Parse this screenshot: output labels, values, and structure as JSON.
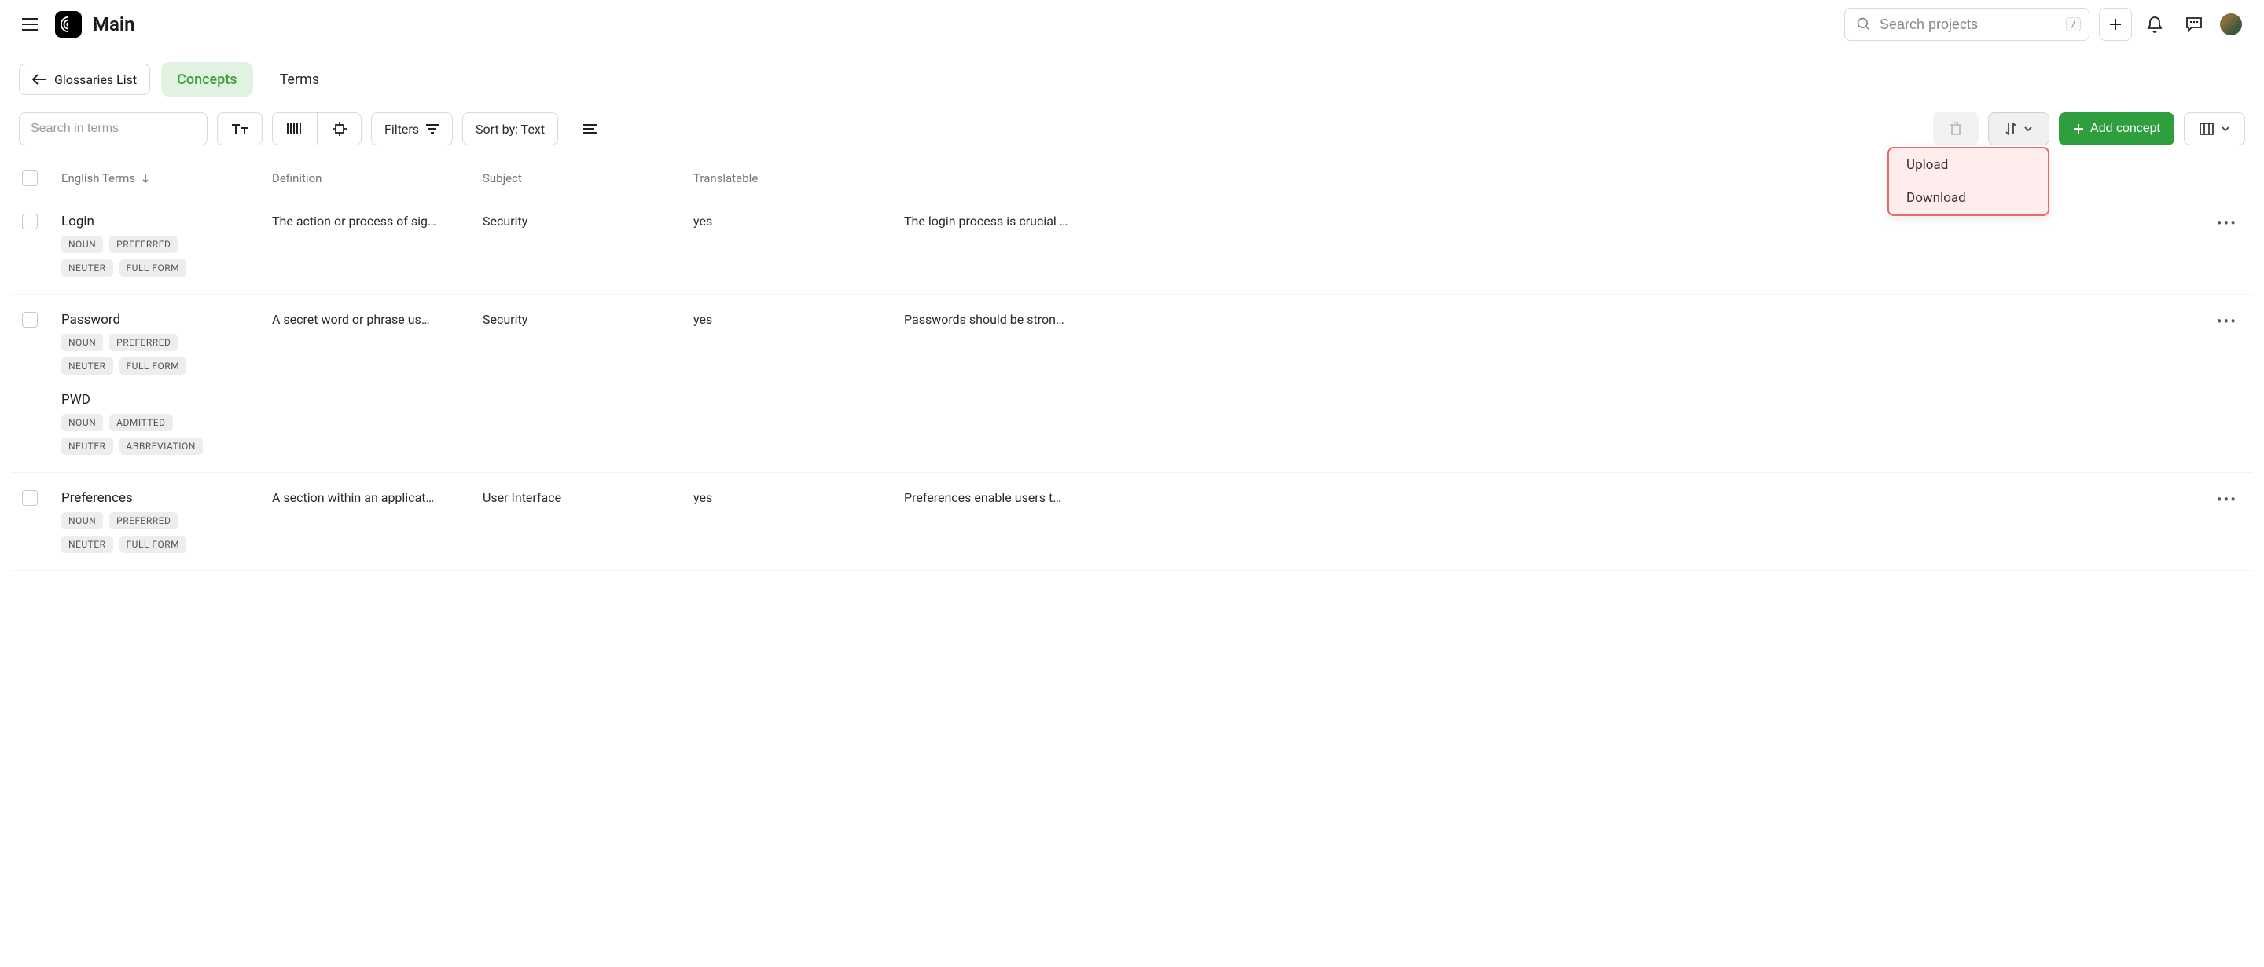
{
  "app": {
    "title": "Main",
    "search_placeholder": "Search projects",
    "search_shortcut": "/"
  },
  "breadcrumb": {
    "back_label": "Glossaries List",
    "tabs": [
      {
        "label": "Concepts",
        "active": true
      },
      {
        "label": "Terms",
        "active": false
      }
    ]
  },
  "toolbar": {
    "search_placeholder": "Search in terms",
    "filters_label": "Filters",
    "sort_label": "Sort by: Text",
    "add_concept_label": "Add concept",
    "upload_download_menu": {
      "upload": "Upload",
      "download": "Download"
    }
  },
  "columns": {
    "term": "English Terms",
    "definition": "Definition",
    "subject": "Subject",
    "translatable": "Translatable",
    "note": ""
  },
  "rows": [
    {
      "term": "Login",
      "tags": [
        "NOUN",
        "PREFERRED",
        "NEUTER",
        "FULL FORM"
      ],
      "variants": [],
      "definition": "The action or process of sig…",
      "subject": "Security",
      "translatable": "yes",
      "note": "The login process is crucial …"
    },
    {
      "term": "Password",
      "tags": [
        "NOUN",
        "PREFERRED",
        "NEUTER",
        "FULL FORM"
      ],
      "variants": [
        {
          "term": "PWD",
          "tags": [
            "NOUN",
            "ADMITTED",
            "NEUTER",
            "ABBREVIATION"
          ]
        }
      ],
      "definition": "A secret word or phrase us…",
      "subject": "Security",
      "translatable": "yes",
      "note": "Passwords should be stron…"
    },
    {
      "term": "Preferences",
      "tags": [
        "NOUN",
        "PREFERRED",
        "NEUTER",
        "FULL FORM"
      ],
      "variants": [],
      "definition": "A section within an applicat…",
      "subject": "User Interface",
      "translatable": "yes",
      "note": "Preferences enable users t…"
    }
  ]
}
